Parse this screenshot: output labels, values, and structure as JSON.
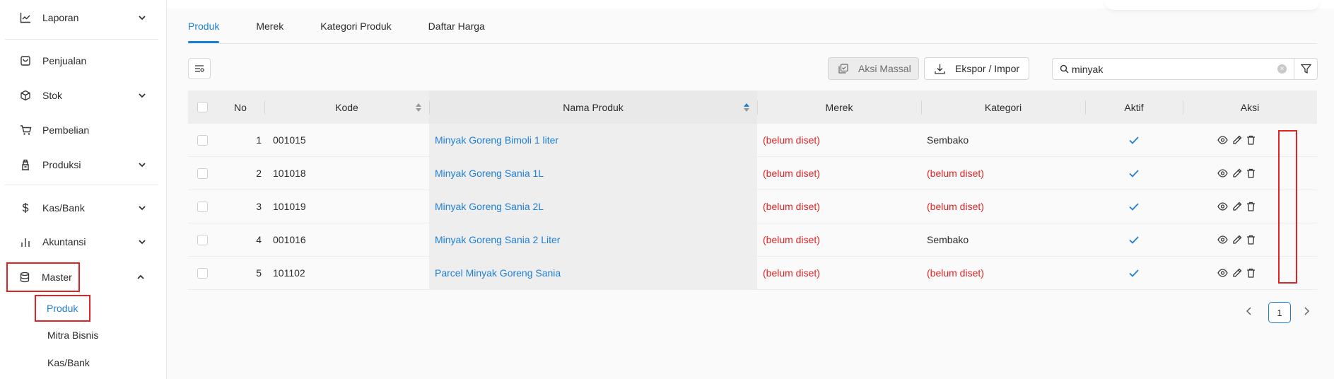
{
  "sidebar": {
    "items": [
      {
        "label": "Laporan",
        "icon": "chart-line-icon",
        "expand": "chevron-down"
      },
      {
        "label": "Penjualan",
        "icon": "shopping-bag-icon",
        "expand": ""
      },
      {
        "label": "Stok",
        "icon": "box-icon",
        "expand": "chevron-down"
      },
      {
        "label": "Pembelian",
        "icon": "cart-icon",
        "expand": ""
      },
      {
        "label": "Produksi",
        "icon": "factory-icon",
        "expand": "chevron-down"
      },
      {
        "label": "Kas/Bank",
        "icon": "dollar-icon",
        "expand": "chevron-down"
      },
      {
        "label": "Akuntansi",
        "icon": "bar-chart-icon",
        "expand": "chevron-down"
      },
      {
        "label": "Master",
        "icon": "database-icon",
        "expand": "chevron-up"
      }
    ],
    "sub_items": [
      {
        "label": "Produk",
        "active": true
      },
      {
        "label": "Mitra Bisnis",
        "active": false
      },
      {
        "label": "Kas/Bank",
        "active": false
      }
    ]
  },
  "tabs": [
    {
      "label": "Produk",
      "active": true
    },
    {
      "label": "Merek",
      "active": false
    },
    {
      "label": "Kategori Produk",
      "active": false
    },
    {
      "label": "Daftar Harga",
      "active": false
    }
  ],
  "toolbar": {
    "mass_action_label": "Aksi Massal",
    "export_import_label": "Ekspor / Impor",
    "search_value": "minyak"
  },
  "table": {
    "headers": {
      "no": "No",
      "code": "Kode",
      "name": "Nama Produk",
      "brand": "Merek",
      "category": "Kategori",
      "active": "Aktif",
      "actions": "Aksi"
    },
    "rows": [
      {
        "no": "1",
        "code": "001015",
        "name": "Minyak Goreng Bimoli 1 liter",
        "brand": "(belum diset)",
        "category": "Sembako",
        "category_unset": false,
        "active": true
      },
      {
        "no": "2",
        "code": "101018",
        "name": "Minyak Goreng Sania 1L",
        "brand": "(belum diset)",
        "category": "(belum diset)",
        "category_unset": true,
        "active": true
      },
      {
        "no": "3",
        "code": "101019",
        "name": "Minyak Goreng Sania 2L",
        "brand": "(belum diset)",
        "category": "(belum diset)",
        "category_unset": true,
        "active": true
      },
      {
        "no": "4",
        "code": "001016",
        "name": "Minyak Goreng Sania 2 Liter",
        "brand": "(belum diset)",
        "category": "Sembako",
        "category_unset": false,
        "active": true
      },
      {
        "no": "5",
        "code": "101102",
        "name": "Parcel Minyak Goreng Sania",
        "brand": "(belum diset)",
        "category": "(belum diset)",
        "category_unset": true,
        "active": true
      }
    ]
  },
  "pagination": {
    "current_page": "1"
  },
  "colors": {
    "accent": "#1e7fd6",
    "warning": "#e02424",
    "highlight": "#e02424"
  }
}
